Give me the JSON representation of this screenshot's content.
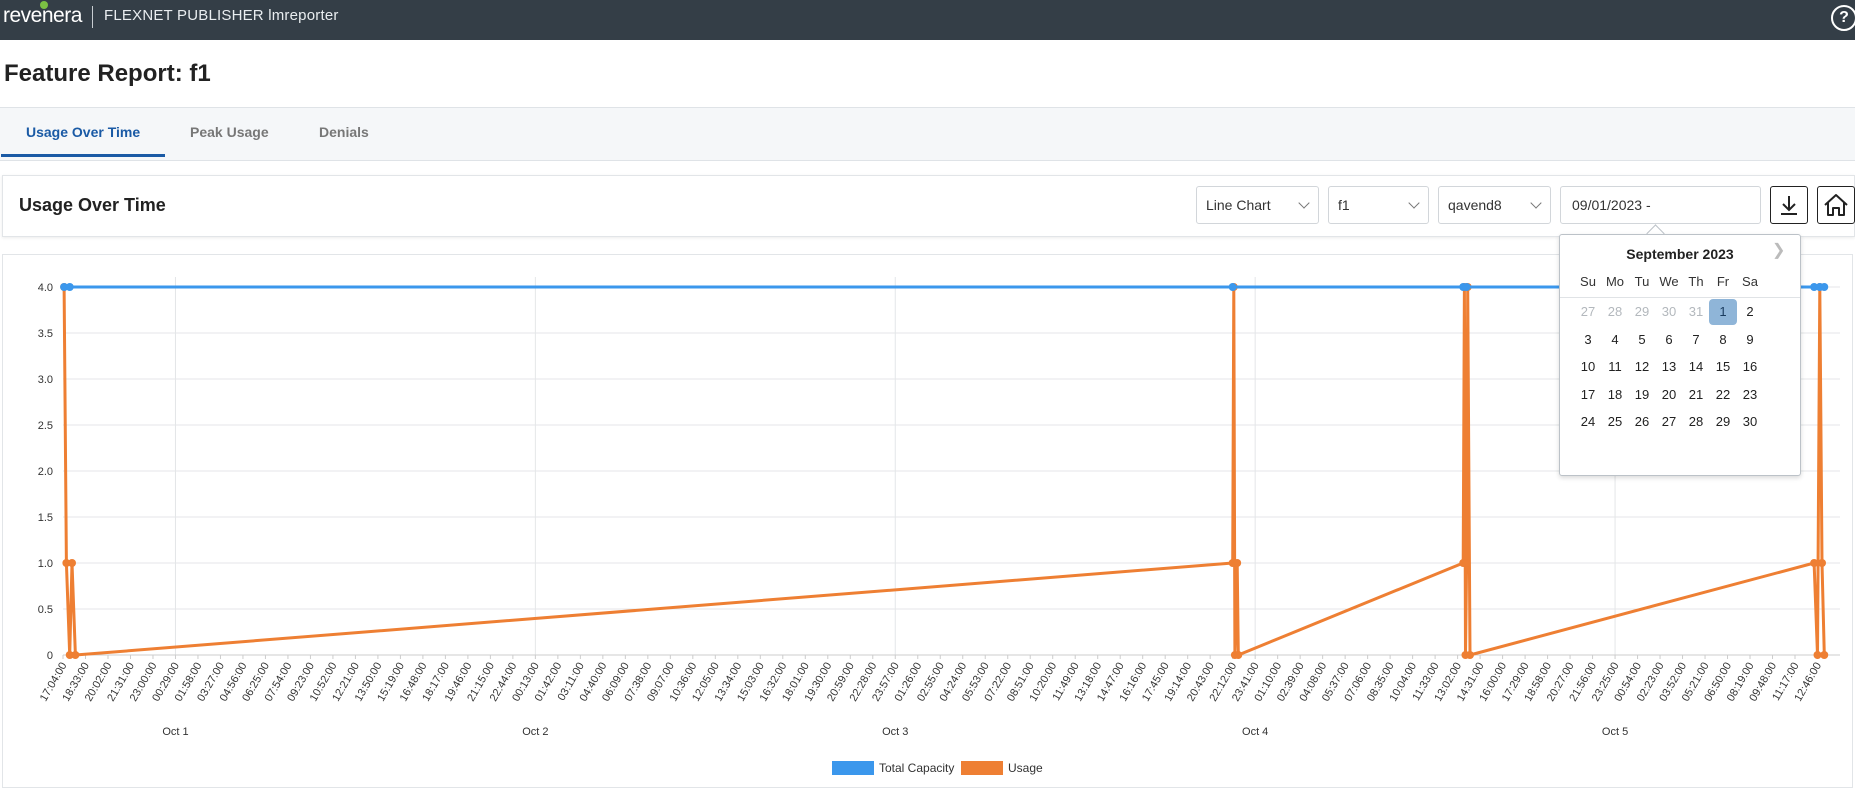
{
  "header": {
    "brand": "revenera",
    "app_name": "FLEXNET PUBLISHER lmreporter",
    "help_label": "?"
  },
  "page": {
    "title": "Feature Report: f1"
  },
  "tabs": [
    {
      "label": "Usage Over Time",
      "active": true
    },
    {
      "label": "Peak Usage",
      "active": false
    },
    {
      "label": "Denials",
      "active": false
    }
  ],
  "toolbar": {
    "title": "Usage Over Time",
    "chart_type": "Line Chart",
    "feature": "f1",
    "server": "qavend8",
    "date_range": "09/01/2023 -",
    "download_icon": "download-icon",
    "home_icon": "home-icon"
  },
  "calendar": {
    "month_label": "September 2023",
    "weekdays": [
      "Su",
      "Mo",
      "Tu",
      "We",
      "Th",
      "Fr",
      "Sa"
    ],
    "weeks": [
      [
        {
          "d": "27",
          "m": true
        },
        {
          "d": "28",
          "m": true
        },
        {
          "d": "29",
          "m": true
        },
        {
          "d": "30",
          "m": true
        },
        {
          "d": "31",
          "m": true
        },
        {
          "d": "1",
          "s": true
        },
        {
          "d": "2"
        }
      ],
      [
        {
          "d": "3"
        },
        {
          "d": "4"
        },
        {
          "d": "5"
        },
        {
          "d": "6"
        },
        {
          "d": "7"
        },
        {
          "d": "8"
        },
        {
          "d": "9"
        }
      ],
      [
        {
          "d": "10"
        },
        {
          "d": "11"
        },
        {
          "d": "12"
        },
        {
          "d": "13"
        },
        {
          "d": "14"
        },
        {
          "d": "15"
        },
        {
          "d": "16"
        }
      ],
      [
        {
          "d": "17"
        },
        {
          "d": "18"
        },
        {
          "d": "19"
        },
        {
          "d": "20"
        },
        {
          "d": "21"
        },
        {
          "d": "22"
        },
        {
          "d": "23"
        }
      ],
      [
        {
          "d": "24"
        },
        {
          "d": "25"
        },
        {
          "d": "26"
        },
        {
          "d": "27"
        },
        {
          "d": "28"
        },
        {
          "d": "29"
        },
        {
          "d": "30"
        }
      ]
    ]
  },
  "chart_data": {
    "type": "line",
    "title": "",
    "xlabel": "",
    "ylabel": "",
    "ylim": [
      0,
      4
    ],
    "y_ticks": [
      "4.0",
      "3.5",
      "3.0",
      "2.5",
      "2.0",
      "1.5",
      "1.0",
      "0.5",
      "0"
    ],
    "x_tick_labels": [
      "17:04:00",
      "18:33:00",
      "20:02:00",
      "21:31:00",
      "23:00:00",
      "00:29:00",
      "01:58:00",
      "03:27:00",
      "04:56:00",
      "06:25:00",
      "07:54:00",
      "09:23:00",
      "10:52:00",
      "12:21:00",
      "13:50:00",
      "15:19:00",
      "16:48:00",
      "18:17:00",
      "19:46:00",
      "21:15:00",
      "22:44:00",
      "00:13:00",
      "01:42:00",
      "03:11:00",
      "04:40:00",
      "06:09:00",
      "07:38:00",
      "09:07:00",
      "10:36:00",
      "12:05:00",
      "13:34:00",
      "15:03:00",
      "16:32:00",
      "18:01:00",
      "19:30:00",
      "20:59:00",
      "22:28:00",
      "23:57:00",
      "01:26:00",
      "02:55:00",
      "04:24:00",
      "05:53:00",
      "07:22:00",
      "08:51:00",
      "10:20:00",
      "11:49:00",
      "13:18:00",
      "14:47:00",
      "16:16:00",
      "17:45:00",
      "19:14:00",
      "20:43:00",
      "22:12:00",
      "23:41:00",
      "01:10:00",
      "02:39:00",
      "04:08:00",
      "05:37:00",
      "07:06:00",
      "08:35:00",
      "10:04:00",
      "11:33:00",
      "13:02:00",
      "14:31:00",
      "16:00:00",
      "17:29:00",
      "18:58:00",
      "20:27:00",
      "21:56:00",
      "23:25:00",
      "00:54:00",
      "02:23:00",
      "03:52:00",
      "05:21:00",
      "06:50:00",
      "08:19:00",
      "09:48:00",
      "11:17:00",
      "12:46:00"
    ],
    "x_day_labels": [
      {
        "label": "Oct 1",
        "tick_index": 5
      },
      {
        "label": "Oct 2",
        "tick_index": 21
      },
      {
        "label": "Oct 3",
        "tick_index": 37
      },
      {
        "label": "Oct 4",
        "tick_index": 53
      },
      {
        "label": "Oct 5",
        "tick_index": 69
      }
    ],
    "x_range_ticks": [
      0,
      79
    ],
    "series": [
      {
        "name": "Total Capacity",
        "color": "#3b97ec",
        "points": [
          [
            0.05,
            4
          ],
          [
            0.3,
            4
          ],
          [
            52.0,
            4
          ],
          [
            62.25,
            4
          ],
          [
            62.4,
            4
          ],
          [
            77.85,
            4
          ],
          [
            78.1,
            4
          ],
          [
            78.3,
            4
          ]
        ]
      },
      {
        "name": "Usage",
        "color": "#ee7f33",
        "points": [
          [
            0.05,
            4
          ],
          [
            0.15,
            1
          ],
          [
            0.3,
            0
          ],
          [
            0.4,
            1
          ],
          [
            0.55,
            0
          ],
          [
            52.0,
            1
          ],
          [
            52.05,
            4
          ],
          [
            52.1,
            0
          ],
          [
            52.2,
            1
          ],
          [
            52.25,
            0
          ],
          [
            62.25,
            1
          ],
          [
            62.3,
            4
          ],
          [
            62.35,
            0
          ],
          [
            62.4,
            1
          ],
          [
            62.45,
            4
          ],
          [
            62.55,
            0
          ],
          [
            77.85,
            1
          ],
          [
            78.0,
            0
          ],
          [
            78.1,
            4
          ],
          [
            78.2,
            1
          ],
          [
            78.3,
            0
          ]
        ]
      }
    ],
    "legend": {
      "position": "bottom-center",
      "items": [
        "Total Capacity",
        "Usage"
      ]
    },
    "grid": true
  }
}
